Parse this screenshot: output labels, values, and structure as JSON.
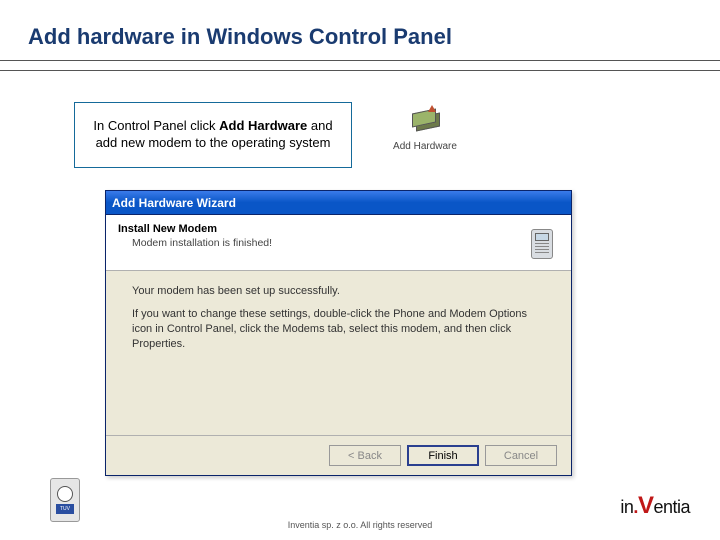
{
  "slide": {
    "title": "Add hardware in Windows Control Panel",
    "instruction_prefix": "In Control Panel click ",
    "instruction_bold": "Add Hardware",
    "instruction_suffix": " and add new modem to the operating system",
    "add_hw_icon_label": "Add Hardware"
  },
  "wizard": {
    "titlebar": "Add Hardware Wizard",
    "header_title": "Install New Modem",
    "header_subtitle": "Modem installation is finished!",
    "body_line1": "Your modem has been set up successfully.",
    "body_line2": "If you want to change these settings, double-click the Phone and Modem Options icon in Control Panel, click the Modems tab, select this modem, and then click Properties.",
    "buttons": {
      "back": "< Back",
      "finish": "Finish",
      "cancel": "Cancel"
    }
  },
  "footer": {
    "copyright": "Inventia sp. z o.o. All rights reserved",
    "tuv_label": "TUV",
    "logo_text_in": "in",
    "logo_text_dot": ".",
    "logo_text_V": "V",
    "logo_text_entia": "entia"
  }
}
